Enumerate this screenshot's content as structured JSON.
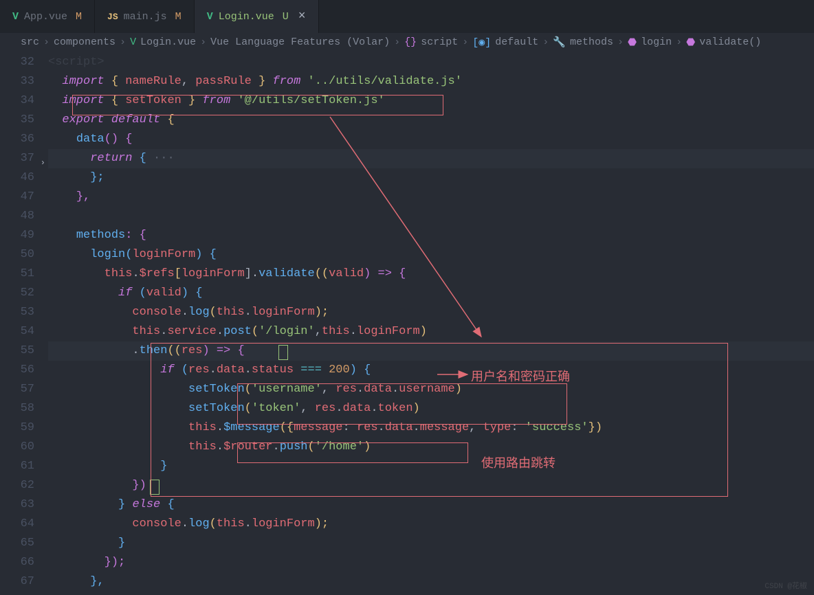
{
  "tabs": [
    {
      "icon": "vue",
      "name": "App.vue",
      "mod": "M"
    },
    {
      "icon": "js",
      "name": "main.js",
      "mod": "M"
    },
    {
      "icon": "vue",
      "name": "Login.vue",
      "mod": "U",
      "close": true
    }
  ],
  "breadcrumb": {
    "p0": "src",
    "p1": "components",
    "p2": "Login.vue",
    "p3": "Vue Language Features (Volar)",
    "p4": "script",
    "p5": "default",
    "p6": "methods",
    "p7": "login",
    "p8": "validate()"
  },
  "gutter": [
    "32",
    "33",
    "34",
    "35",
    "36",
    "37",
    "46",
    "47",
    "48",
    "49",
    "50",
    "51",
    "52",
    "53",
    "54",
    "55",
    "56",
    "57",
    "58",
    "59",
    "60",
    "61",
    "62",
    "63",
    "64",
    "65",
    "66",
    "67"
  ],
  "code": {
    "l32a": "<script>",
    "l33_import": "import",
    "l33_brace_o": " { ",
    "l33_nameRule": "nameRule",
    "l33_comma": ", ",
    "l33_passRule": "passRule",
    "l33_brace_c": " } ",
    "l33_from": "from",
    "l33_sp": " ",
    "l33_path": "'../utils/validate.js'",
    "l34_import": "import",
    "l34_brace_o": " { ",
    "l34_setToken": "setToken",
    "l34_brace_c": " } ",
    "l34_from": "from",
    "l34_sp": " ",
    "l34_path": "'@/utils/setToken.js'",
    "l35_export": "export",
    "l35_default": " default",
    "l35_brace": " {",
    "l36_data": "data",
    "l36_paren": "() {",
    "l37_return": "return",
    "l37_brace": " {",
    "l37_dots": " ···",
    "l46_close": "};",
    "l47_close": "},",
    "l49_methods": "methods",
    "l49_colon": ": {",
    "l50_login": "login",
    "l50_paren_o": "(",
    "l50_arg": "loginForm",
    "l50_paren_c": ") {",
    "l51_this": "this",
    "l51_dot1": ".",
    "l51_refs": "$refs",
    "l51_brk_o": "[",
    "l51_lf": "loginForm",
    "l51_brk_c": "].",
    "l51_validate": "validate",
    "l51_cb_o": "((",
    "l51_valid": "valid",
    "l51_cb_c": ") ",
    "l51_arrow": "=>",
    "l51_brace": " {",
    "l52_if": "if",
    "l52_po": " (",
    "l52_valid": "valid",
    "l52_pc": ") {",
    "l53_console": "console",
    "l53_dot": ".",
    "l53_log": "log",
    "l53_po": "(",
    "l53_this": "this",
    "l53_dot2": ".",
    "l53_lf": "loginForm",
    "l53_pc": ");",
    "l54_this": "this",
    "l54_d1": ".",
    "l54_service": "service",
    "l54_d2": ".",
    "l54_post": "post",
    "l54_po": "(",
    "l54_url": "'/login'",
    "l54_comma": ",",
    "l54_this2": "this",
    "l54_d3": ".",
    "l54_lf": "loginForm",
    "l54_pc": ")",
    "l55_dot": ".",
    "l55_then": "then",
    "l55_po": "((",
    "l55_res": "res",
    "l55_pc": ") ",
    "l55_arrow": "=>",
    "l55_brace": " {",
    "l56_if": "if",
    "l56_po": " (",
    "l56_res": "res",
    "l56_d1": ".",
    "l56_data": "data",
    "l56_d2": ".",
    "l56_status": "status",
    "l56_eq": " === ",
    "l56_200": "200",
    "l56_pc": ") {",
    "l57_setToken": "setToken",
    "l57_po": "(",
    "l57_k": "'username'",
    "l57_c": ", ",
    "l57_res": "res",
    "l57_d1": ".",
    "l57_data": "data",
    "l57_d2": ".",
    "l57_username": "username",
    "l57_pc": ")",
    "l58_setToken": "setToken",
    "l58_po": "(",
    "l58_k": "'token'",
    "l58_c": ", ",
    "l58_res": "res",
    "l58_d1": ".",
    "l58_data": "data",
    "l58_d2": ".",
    "l58_token": "token",
    "l58_pc": ")",
    "l59_this": "this",
    "l59_d1": ".",
    "l59_msg": "$message",
    "l59_po": "({",
    "l59_mk": "message",
    "l59_col": ": ",
    "l59_res": "res",
    "l59_d2": ".",
    "l59_data": "data",
    "l59_d3": ".",
    "l59_message": "message",
    "l59_c": ", ",
    "l59_tk": "type",
    "l59_col2": ": ",
    "l59_tv": "'success'",
    "l59_pc": "})",
    "l60_this": "this",
    "l60_d1": ".",
    "l60_router": "$router",
    "l60_d2": ".",
    "l60_push": "push",
    "l60_po": "(",
    "l60_home": "'/home'",
    "l60_pc": ")",
    "l61_close": "}",
    "l62_close": "})",
    "l63_else_b": "} ",
    "l63_else": "else",
    "l63_brace": " {",
    "l64_console": "console",
    "l64_dot": ".",
    "l64_log": "log",
    "l64_po": "(",
    "l64_this": "this",
    "l64_dot2": ".",
    "l64_lf": "loginForm",
    "l64_pc": ");",
    "l65_close": "}",
    "l66_close": "});",
    "l67_close": "},"
  },
  "annotations": {
    "a1": "用户名和密码正确",
    "a2": "使用路由跳转"
  },
  "watermark": "CSDN @花椒"
}
